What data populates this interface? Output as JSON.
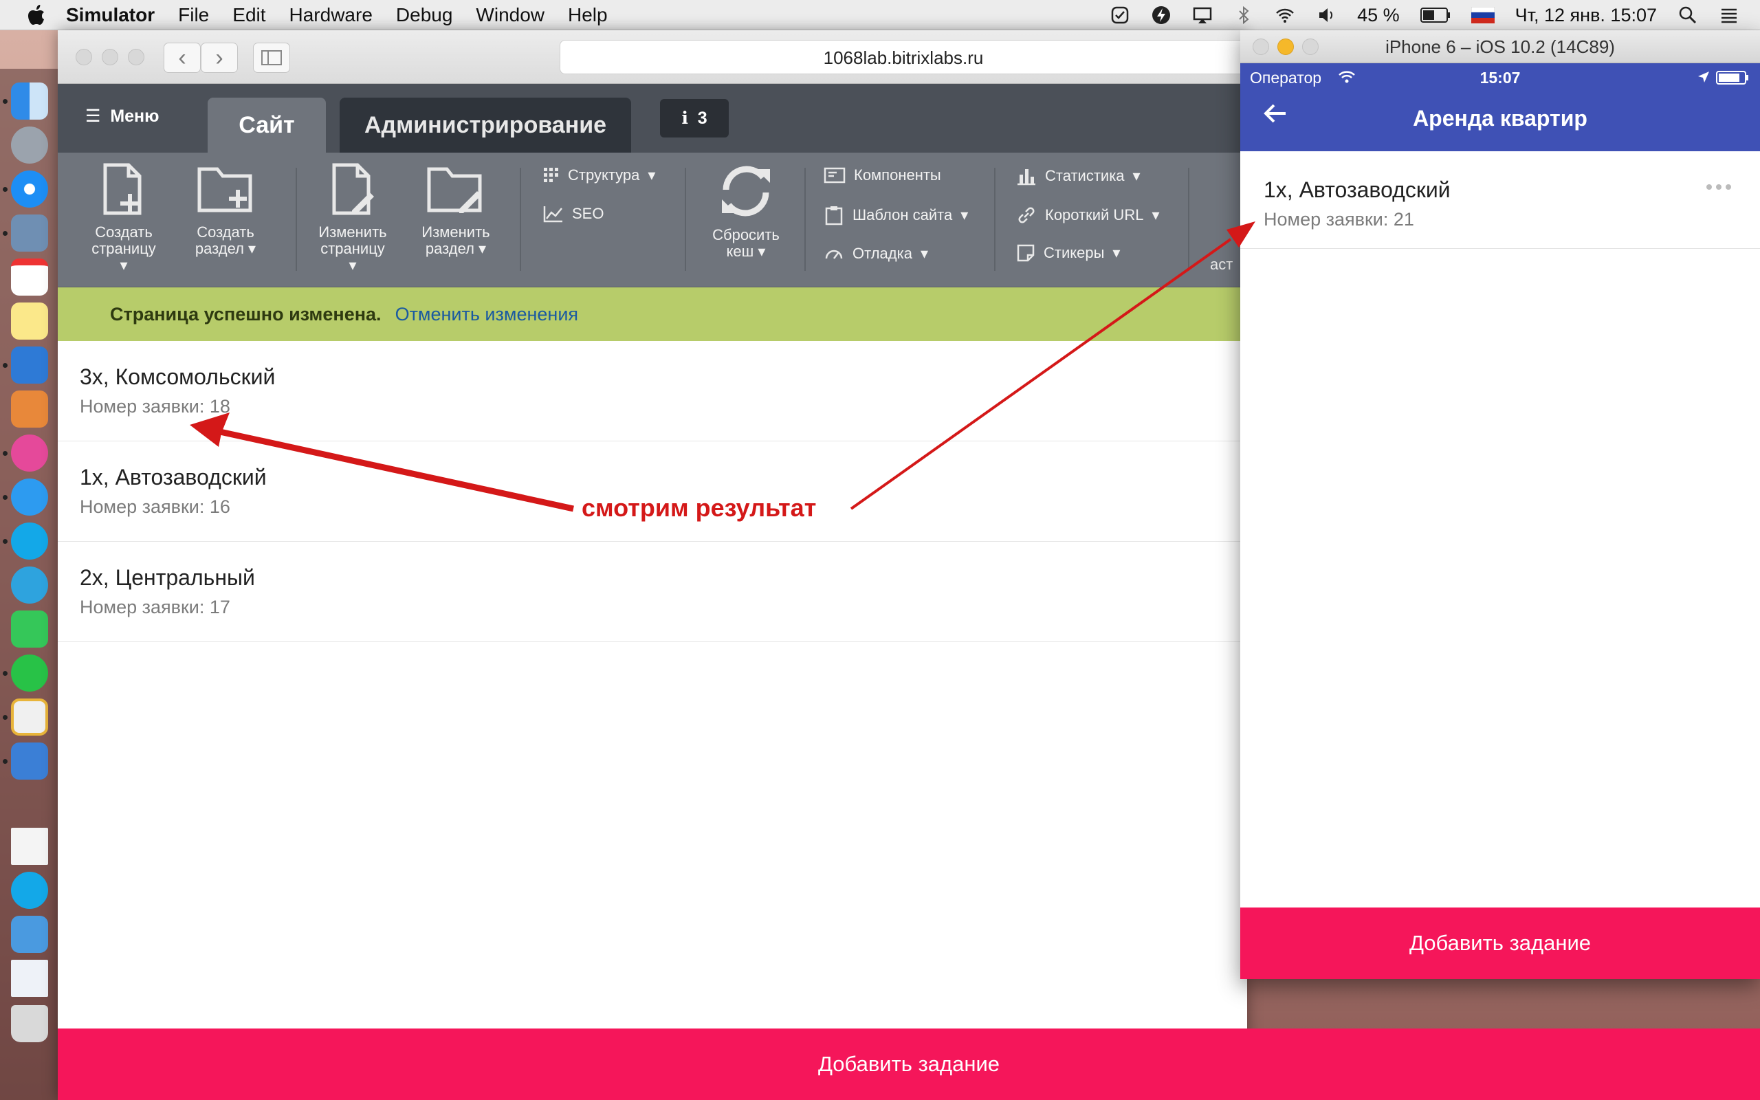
{
  "menubar": {
    "app_name": "Simulator",
    "menus": [
      "File",
      "Edit",
      "Hardware",
      "Debug",
      "Window",
      "Help"
    ],
    "battery_text": "45 %",
    "datetime": "Чт, 12 янв.  15:07"
  },
  "safari": {
    "url": "1068lab.bitrixlabs.ru"
  },
  "bitrix": {
    "menu_label": "Меню",
    "tab_site": "Сайт",
    "tab_admin": "Администрирование",
    "notify_count": "3",
    "tools": {
      "create_page": [
        "Создать",
        "страницу"
      ],
      "create_section": [
        "Создать",
        "раздел"
      ],
      "edit_page": [
        "Изменить",
        "страницу"
      ],
      "edit_section": [
        "Изменить",
        "раздел"
      ],
      "structure": "Структура",
      "seo": "SEO",
      "reset_cache": [
        "Сбросить",
        "кеш"
      ],
      "components": "Компоненты",
      "site_template": "Шаблон сайта",
      "debug": "Отладка",
      "statistics": "Статистика",
      "short_url": "Короткий URL",
      "stickers": "Стикеры",
      "settings_partial": "аст"
    },
    "message": "Страница успешно изменена.",
    "undo_link": "Отменить изменения"
  },
  "list": [
    {
      "title": "3х, Комсомольский",
      "subtitle": "Номер заявки: 18"
    },
    {
      "title": "1х, Автозаводский",
      "subtitle": "Номер заявки: 16"
    },
    {
      "title": "2х, Центральный",
      "subtitle": "Номер заявки: 17"
    }
  ],
  "add_task": "Добавить задание",
  "simulator": {
    "window_title": "iPhone 6 – iOS 10.2 (14C89)",
    "carrier": "Оператор",
    "time": "15:07",
    "nav_title": "Аренда квартир",
    "item_title": "1х, Автозаводский",
    "item_subtitle": "Номер заявки: 21",
    "add_task": "Добавить задание"
  },
  "annotation": "смотрим результат",
  "colors": {
    "accent": "#f5165a",
    "ios_nav": "#3f51b5",
    "arrow": "#d41818",
    "success_bar": "#b7cc6a"
  }
}
